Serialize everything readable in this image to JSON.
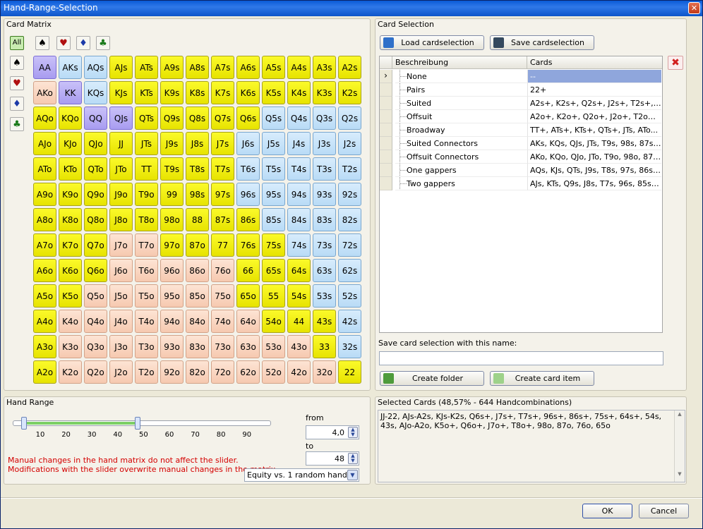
{
  "window": {
    "title": "Hand-Range-Selection"
  },
  "matrix": {
    "title": "Card Matrix",
    "all_label": "All",
    "cells": [
      [
        "AA",
        "AKs",
        "AQs",
        "AJs",
        "ATs",
        "A9s",
        "A8s",
        "A7s",
        "A6s",
        "A5s",
        "A4s",
        "A3s",
        "A2s"
      ],
      [
        "AKo",
        "KK",
        "KQs",
        "KJs",
        "KTs",
        "K9s",
        "K8s",
        "K7s",
        "K6s",
        "K5s",
        "K4s",
        "K3s",
        "K2s"
      ],
      [
        "AQo",
        "KQo",
        "QQ",
        "QJs",
        "QTs",
        "Q9s",
        "Q8s",
        "Q7s",
        "Q6s",
        "Q5s",
        "Q4s",
        "Q3s",
        "Q2s"
      ],
      [
        "AJo",
        "KJo",
        "QJo",
        "JJ",
        "JTs",
        "J9s",
        "J8s",
        "J7s",
        "J6s",
        "J5s",
        "J4s",
        "J3s",
        "J2s"
      ],
      [
        "ATo",
        "KTo",
        "QTo",
        "JTo",
        "TT",
        "T9s",
        "T8s",
        "T7s",
        "T6s",
        "T5s",
        "T4s",
        "T3s",
        "T2s"
      ],
      [
        "A9o",
        "K9o",
        "Q9o",
        "J9o",
        "T9o",
        "99",
        "98s",
        "97s",
        "96s",
        "95s",
        "94s",
        "93s",
        "92s"
      ],
      [
        "A8o",
        "K8o",
        "Q8o",
        "J8o",
        "T8o",
        "98o",
        "88",
        "87s",
        "86s",
        "85s",
        "84s",
        "83s",
        "82s"
      ],
      [
        "A7o",
        "K7o",
        "Q7o",
        "J7o",
        "T7o",
        "97o",
        "87o",
        "77",
        "76s",
        "75s",
        "74s",
        "73s",
        "72s"
      ],
      [
        "A6o",
        "K6o",
        "Q6o",
        "J6o",
        "T6o",
        "96o",
        "86o",
        "76o",
        "66",
        "65s",
        "64s",
        "63s",
        "62s"
      ],
      [
        "A5o",
        "K5o",
        "Q5o",
        "J5o",
        "T5o",
        "95o",
        "85o",
        "75o",
        "65o",
        "55",
        "54s",
        "53s",
        "52s"
      ],
      [
        "A4o",
        "K4o",
        "Q4o",
        "J4o",
        "T4o",
        "94o",
        "84o",
        "74o",
        "64o",
        "54o",
        "44",
        "43s",
        "42s"
      ],
      [
        "A3o",
        "K3o",
        "Q3o",
        "J3o",
        "T3o",
        "93o",
        "83o",
        "73o",
        "63o",
        "53o",
        "43o",
        "33",
        "32s"
      ],
      [
        "A2o",
        "K2o",
        "Q2o",
        "J2o",
        "T2o",
        "92o",
        "82o",
        "72o",
        "62o",
        "52o",
        "42o",
        "32o",
        "22"
      ]
    ],
    "states": [
      "pbbyyyyyyyyyy",
      "opbyyyyyyyyyy",
      "yyppyyyyybbbb",
      "yyyyyyyybbbbb",
      "yyyyyyyybbbbb",
      "yyyyyyyybbbbb",
      "yyyyyyyyybbbb",
      "yyyooyyyyybbb",
      "yyyoooooyyybb",
      "yyooooooyyybb",
      "yooooooooyyyb",
      "yooooooooooyb",
      "yoooooooooooy"
    ]
  },
  "card_selection": {
    "title": "Card Selection",
    "load_label": "Load cardselection",
    "save_label": "Save cardselection",
    "col_desc": "Beschreibung",
    "col_cards": "Cards",
    "rows": [
      {
        "desc": "None",
        "cards": "--"
      },
      {
        "desc": "Pairs",
        "cards": "22+"
      },
      {
        "desc": "Suited",
        "cards": "A2s+, K2s+, Q2s+, J2s+, T2s+, 9..."
      },
      {
        "desc": "Offsuit",
        "cards": "A2o+, K2o+, Q2o+, J2o+, T2o+, ..."
      },
      {
        "desc": "Broadway",
        "cards": "TT+, ATs+, KTs+, QTs+, JTs, ATo..."
      },
      {
        "desc": "Suited Connectors",
        "cards": "AKs, KQs, QJs, JTs, T9s, 98s, 87s, ..."
      },
      {
        "desc": "Offsuit Connectors",
        "cards": "AKo, KQo, QJo, JTo, T9o, 98o, 87o..."
      },
      {
        "desc": "One gappers",
        "cards": "AQs, KJs, QTs, J9s, T8s, 97s, 86s, ..."
      },
      {
        "desc": "Two gappers",
        "cards": "AJs, KTs, Q9s, J8s, T7s, 96s, 85s, ..."
      }
    ],
    "save_name_label": "Save card selection with this name:",
    "save_name_value": "",
    "create_folder_label": "Create folder",
    "create_item_label": "Create card item"
  },
  "hand_range": {
    "title": "Hand Range",
    "tick_labels": [
      "10",
      "20",
      "30",
      "40",
      "50",
      "60",
      "70",
      "80",
      "90"
    ],
    "from_label": "from",
    "from_value": "4,0",
    "to_label": "to",
    "to_value": "48",
    "slider_low": 4,
    "slider_high": 48,
    "warning1": "Manual changes in the hand matrix do not affect the slider.",
    "warning2": "Modifications with the slider overwrite manual changes in the matrix.",
    "equity_option": "Equity vs. 1 random hand"
  },
  "selected_cards": {
    "title": "Selected Cards (48,57% - 644 Handcombinations)",
    "text": "JJ-22, AJs-A2s, KJs-K2s, Q6s+, J7s+, T7s+, 96s+, 86s+, 75s+, 64s+, 54s, 43s, AJo-A2o, K5o+, Q6o+, J7o+, T8o+, 98o, 87o, 76o, 65o"
  },
  "footer": {
    "ok_label": "OK",
    "cancel_label": "Cancel"
  }
}
